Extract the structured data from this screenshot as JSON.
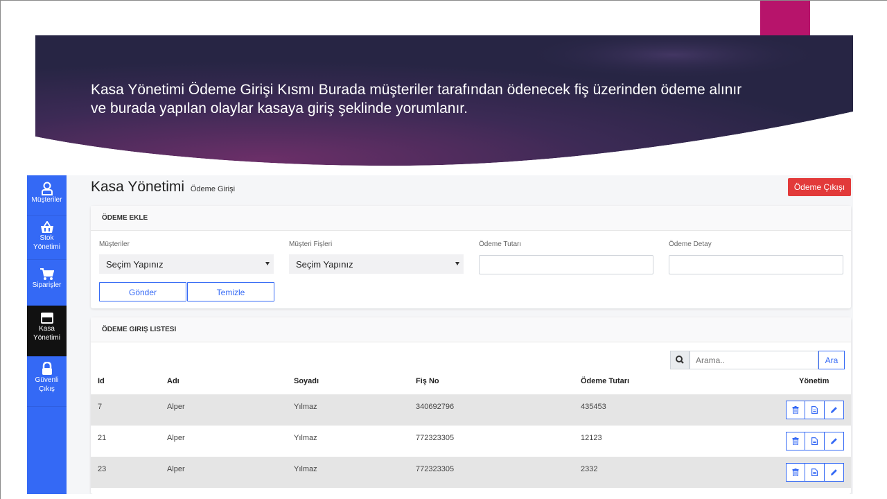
{
  "slide": {
    "caption": "Kasa Yönetimi Ödeme Girişi Kısmı Burada müşteriler tarafından ödenecek fiş üzerinden ödeme alınır ve burada yapılan olaylar kasaya giriş şeklinde yorumlanır.",
    "accent_color": "#b7146b"
  },
  "sidebar": {
    "items": [
      {
        "label": "Müşteriler",
        "icon": "user-icon"
      },
      {
        "label": "Stok Yönetimi",
        "icon": "basket-icon"
      },
      {
        "label": "Siparişler",
        "icon": "cart-icon"
      },
      {
        "label": "Kasa Yönetimi",
        "icon": "wallet-icon",
        "active": true
      },
      {
        "label": "Güvenli Çıkış",
        "icon": "lock-icon"
      }
    ]
  },
  "header": {
    "title": "Kasa Yönetimi",
    "subtitle": "Ödeme Girişi",
    "exit_button": "Ödeme Çıkışı"
  },
  "add_form": {
    "title": "ÖDEME EKLE",
    "customers_label": "Müşteriler",
    "customers_value": "Seçim Yapınız",
    "receipts_label": "Müşteri Fişleri",
    "receipts_value": "Seçim Yapınız",
    "amount_label": "Ödeme Tutarı",
    "detail_label": "Ödeme Detay",
    "submit_label": "Gönder",
    "clear_label": "Temizle"
  },
  "list": {
    "title": "ÖDEME GIRIŞ LISTESI",
    "search_placeholder": "Arama..",
    "search_button": "Ara",
    "columns": [
      "Id",
      "Adı",
      "Soyadı",
      "Fiş No",
      "Ödeme Tutarı",
      "Yönetim"
    ],
    "rows": [
      {
        "id": "7",
        "name": "Alper",
        "surname": "Yılmaz",
        "receipt": "340692796",
        "amount": "435453"
      },
      {
        "id": "21",
        "name": "Alper",
        "surname": "Yılmaz",
        "receipt": "772323305",
        "amount": "12123"
      },
      {
        "id": "23",
        "name": "Alper",
        "surname": "Yılmaz",
        "receipt": "772323305",
        "amount": "2332"
      }
    ]
  },
  "colors": {
    "sidebar": "#3469f5",
    "danger": "#e23a3a",
    "primary": "#3469f5"
  }
}
